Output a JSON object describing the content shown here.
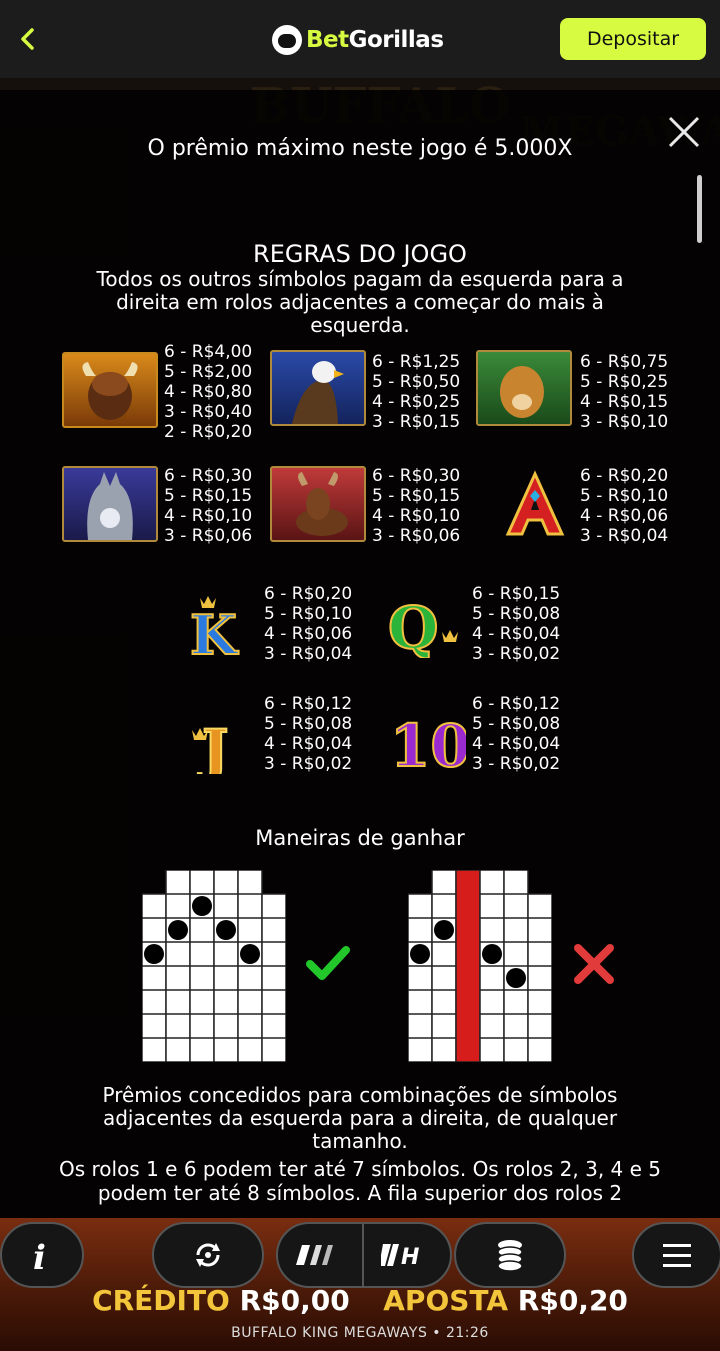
{
  "header": {
    "brand_bet": "Bet",
    "brand_rest": "Gorillas",
    "deposit_label": "Depositar"
  },
  "dialog": {
    "max_prize": "O prêmio máximo neste jogo é 5.000X",
    "rules_title": "REGRAS DO JOGO",
    "rules_desc": "Todos os outros símbolos pagam da esquerda para a direita em rolos adjacentes a começar do mais à esquerda.",
    "ways_title": "Maneiras de ganhar",
    "desc_awards": "Prêmios concedidos para combinações de símbolos adjacentes da esquerda para a direita, de qualquer tamanho.",
    "desc_reels": "Os rolos 1 e 6 podem ter até 7 símbolos. Os rolos 2, 3, 4 e 5 podem ter até 8 símbolos. A fila superior dos rolos 2"
  },
  "paytable": [
    {
      "symbol": "buffalo",
      "pays": [
        "6 - R$4,00",
        "5 - R$2,00",
        "4 - R$0,80",
        "3 - R$0,40",
        "2 - R$0,20"
      ]
    },
    {
      "symbol": "eagle",
      "pays": [
        "6 - R$1,25",
        "5 - R$0,50",
        "4 - R$0,25",
        "3 - R$0,15"
      ]
    },
    {
      "symbol": "cougar",
      "pays": [
        "6 - R$0,75",
        "5 - R$0,25",
        "4 - R$0,15",
        "3 - R$0,10"
      ]
    },
    {
      "symbol": "wolf",
      "pays": [
        "6 - R$0,30",
        "5 - R$0,15",
        "4 - R$0,10",
        "3 - R$0,06"
      ]
    },
    {
      "symbol": "moose",
      "pays": [
        "6 - R$0,30",
        "5 - R$0,15",
        "4 - R$0,10",
        "3 - R$0,06"
      ]
    },
    {
      "symbol": "A",
      "pays": [
        "6 - R$0,20",
        "5 - R$0,10",
        "4 - R$0,06",
        "3 - R$0,04"
      ]
    },
    {
      "symbol": "K",
      "pays": [
        "6 - R$0,20",
        "5 - R$0,10",
        "4 - R$0,06",
        "3 - R$0,04"
      ]
    },
    {
      "symbol": "Q",
      "pays": [
        "6 - R$0,15",
        "5 - R$0,08",
        "4 - R$0,04",
        "3 - R$0,02"
      ]
    },
    {
      "symbol": "J",
      "pays": [
        "6 - R$0,12",
        "5 - R$0,08",
        "4 - R$0,04",
        "3 - R$0,02"
      ]
    },
    {
      "symbol": "10",
      "pays": [
        "6 - R$0,12",
        "5 - R$0,08",
        "4 - R$0,04",
        "3 - R$0,02"
      ]
    }
  ],
  "bottom": {
    "credit_label": "CRÉDITO",
    "credit_value": "R$0,00",
    "bet_label": "APOSTA",
    "bet_value": "R$0,20",
    "footer": "BUFFALO KING MEGAWAYS • 21:26"
  },
  "colors": {
    "brand_accent": "#d6fb41",
    "gold": "#f3c53a",
    "check": "#22c82a",
    "cross": "#e23b3b",
    "blocked_reel": "#d71c1c"
  }
}
